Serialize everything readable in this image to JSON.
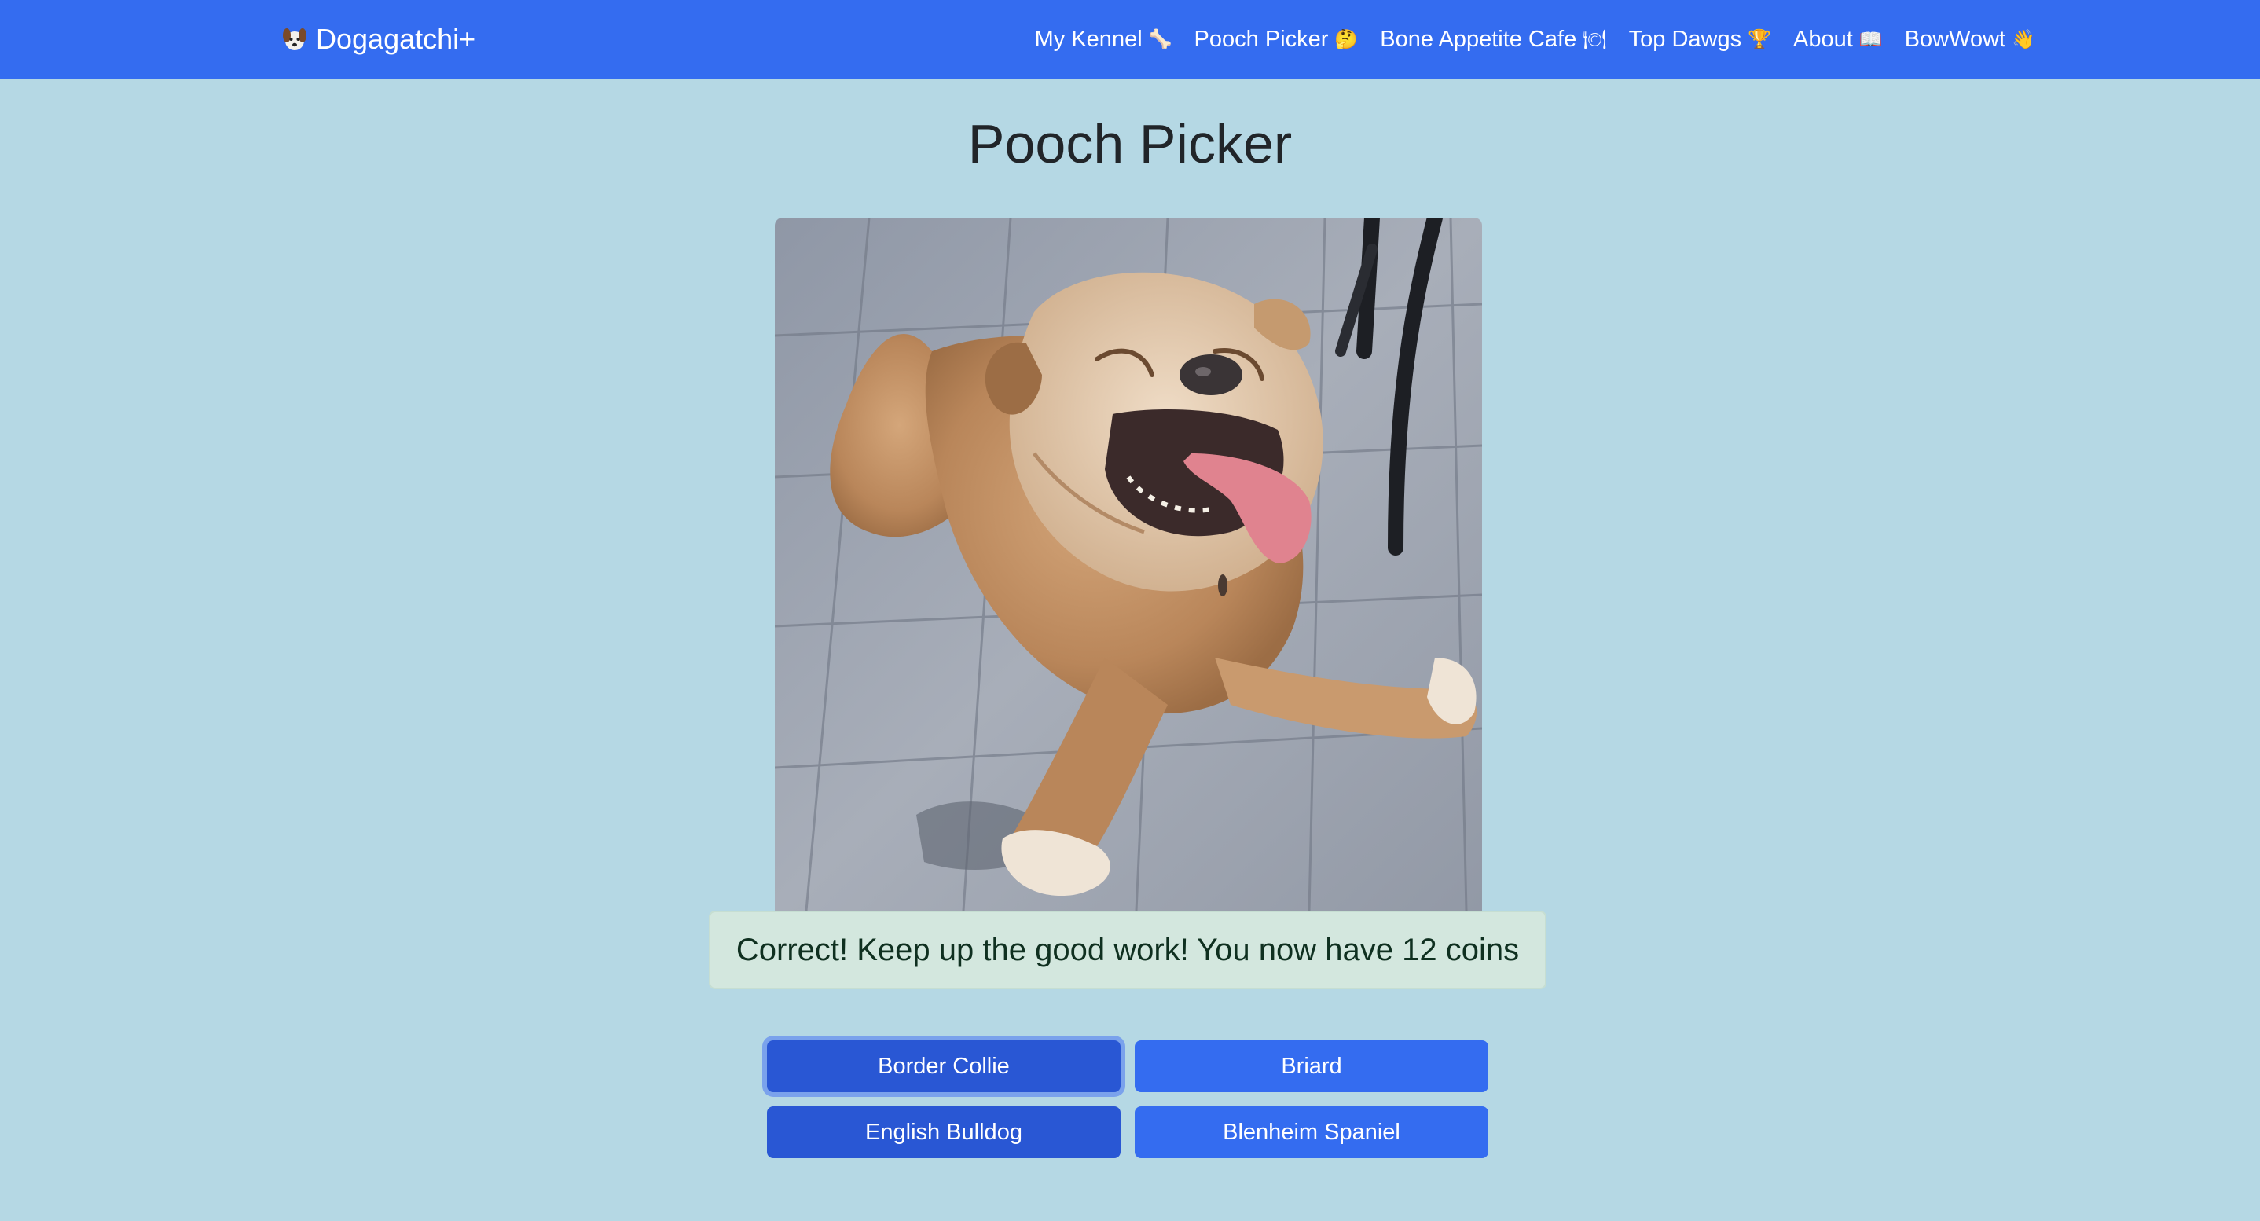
{
  "navbar": {
    "brand": "Dogagatchi+",
    "brand_icon": "dog-face-icon",
    "links": [
      {
        "label": "My Kennel",
        "emoji": "🦴",
        "icon": "bone-icon"
      },
      {
        "label": "Pooch Picker",
        "emoji": "🤔",
        "icon": "thinking-face-icon"
      },
      {
        "label": "Bone Appetite Cafe",
        "emoji": "🍽",
        "icon": "plate-icon"
      },
      {
        "label": "Top Dawgs",
        "emoji": "🏆",
        "icon": "trophy-icon"
      },
      {
        "label": "About",
        "emoji": "📖",
        "icon": "book-icon"
      },
      {
        "label": "BowWowt",
        "emoji": "👋",
        "icon": "waving-hand-icon"
      }
    ]
  },
  "page": {
    "title": "Pooch Picker"
  },
  "feedback": {
    "message": "Correct! Keep up the good work! You now have 12 coins"
  },
  "answers": [
    {
      "label": "Border Collie",
      "state": "focused"
    },
    {
      "label": "Briard",
      "state": "default"
    },
    {
      "label": "English Bulldog",
      "state": "correct"
    },
    {
      "label": "Blenheim Spaniel",
      "state": "default"
    }
  ],
  "colors": {
    "navbar": "#346cf0",
    "background": "#b5d8e4",
    "button": "#346cf0",
    "button_active": "#2957d4",
    "alert_bg": "#d3e7de",
    "alert_text": "#0f3020"
  }
}
